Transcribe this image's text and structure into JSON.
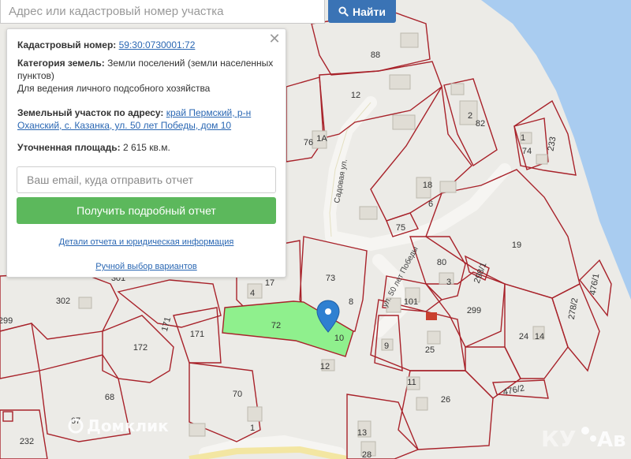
{
  "search": {
    "placeholder": "Адрес или кадастровый номер участка",
    "button_label": "Найти"
  },
  "popup": {
    "cadastral_label": "Кадастровый номер:",
    "cadastral_value": "59:30:0730001:72",
    "category_label": "Категория земель:",
    "category_value": "Земли поселений (земли населенных пунктов)",
    "purpose": "Для ведения личного подсобного хозяйства",
    "address_label": "Земельный участок по адресу:",
    "address_value": "край Пермский, р-н Оханский, с. Казанка, ул. 50 лет Победы, дом 10",
    "area_label": "Уточненная площадь:",
    "area_value": "2 615 кв.м.",
    "email_placeholder": "Ваш email, куда отправить отчет",
    "report_button": "Получить подробный отчет",
    "details_link": "Детали отчета и юридическая информация",
    "manual_link": "Ручной выбор вариантов",
    "close_icon": "close-icon"
  },
  "map": {
    "streets": [
      "Садовая ул.",
      "ул. 50 лет Победы"
    ],
    "plots": [
      "88",
      "12",
      "76",
      "1А",
      "2",
      "82",
      "1",
      "74",
      "233",
      "18",
      "6",
      "75",
      "19",
      "80",
      "3",
      "298/1",
      "476/1",
      "73",
      "17",
      "4",
      "301",
      "302",
      "299",
      "101",
      "299",
      "278/2",
      "72",
      "10",
      "171",
      "171",
      "172",
      "8",
      "12",
      "25",
      "24",
      "14",
      "9",
      "11",
      "476/2",
      "26",
      "68",
      "70",
      "67",
      "232",
      "1",
      "13",
      "28"
    ],
    "selected_plot_color": "#8ff08d",
    "marker_color": "#2f80d1",
    "water_color": "#a9ccf0",
    "boundary_color": "#a8222a"
  },
  "watermarks": {
    "left": "Домклик",
    "right": "Авито"
  }
}
